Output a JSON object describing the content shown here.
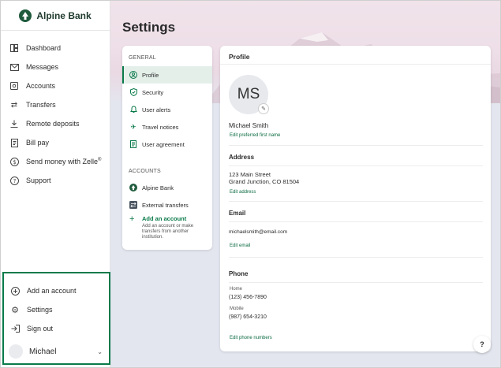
{
  "brand": {
    "name": "Alpine Bank",
    "accent": "#0a7a4a"
  },
  "sidebar": {
    "items": [
      {
        "label": "Dashboard",
        "icon": "dashboard-icon"
      },
      {
        "label": "Messages",
        "icon": "mail-icon"
      },
      {
        "label": "Accounts",
        "icon": "accounts-icon"
      },
      {
        "label": "Transfers",
        "icon": "transfer-arrows-icon"
      },
      {
        "label": "Remote deposits",
        "icon": "download-icon"
      },
      {
        "label": "Bill pay",
        "icon": "bill-icon"
      },
      {
        "label": "Send money with Zelle",
        "sup": "®",
        "icon": "dollar-circle-icon"
      },
      {
        "label": "Support",
        "icon": "help-circle-icon"
      }
    ],
    "bottom": [
      {
        "label": "Add an account",
        "icon": "plus-circle-icon"
      },
      {
        "label": "Settings",
        "icon": "gear-icon"
      },
      {
        "label": "Sign out",
        "icon": "sign-out-icon"
      }
    ],
    "user": {
      "name": "Michael"
    }
  },
  "page": {
    "title": "Settings"
  },
  "settings_nav": {
    "general_label": "GENERAL",
    "general": [
      {
        "label": "Profile",
        "icon": "user-circle-icon",
        "active": true
      },
      {
        "label": "Security",
        "icon": "shield-icon"
      },
      {
        "label": "User alerts",
        "icon": "bell-icon"
      },
      {
        "label": "Travel notices",
        "icon": "plane-icon"
      },
      {
        "label": "User agreement",
        "icon": "document-icon"
      }
    ],
    "accounts_label": "ACCOUNTS",
    "accounts": [
      {
        "label": "Alpine Bank",
        "icon": "alpine-logo-icon"
      },
      {
        "label": "External transfers",
        "icon": "transfer-icon"
      }
    ],
    "add_account": {
      "title": "Add an account",
      "description": "Add an account or make transfers from another institution."
    }
  },
  "profile": {
    "title": "Profile",
    "initials": "MS",
    "name": "Michael Smith",
    "edit_name": "Edit preferred first name",
    "address_title": "Address",
    "address_line1": "123 Main Street",
    "address_line2": "Grand Junction, CO 81504",
    "edit_address": "Edit address",
    "email_title": "Email",
    "email": "michaelsmith@email.com",
    "edit_email": "Edit email",
    "phone_title": "Phone",
    "home_label": "Home",
    "home_number": "(123) 456-7890",
    "mobile_label": "Mobile",
    "mobile_number": "(987) 654-3210",
    "edit_phone": "Edit phone numbers"
  },
  "help": {
    "label": "?"
  }
}
